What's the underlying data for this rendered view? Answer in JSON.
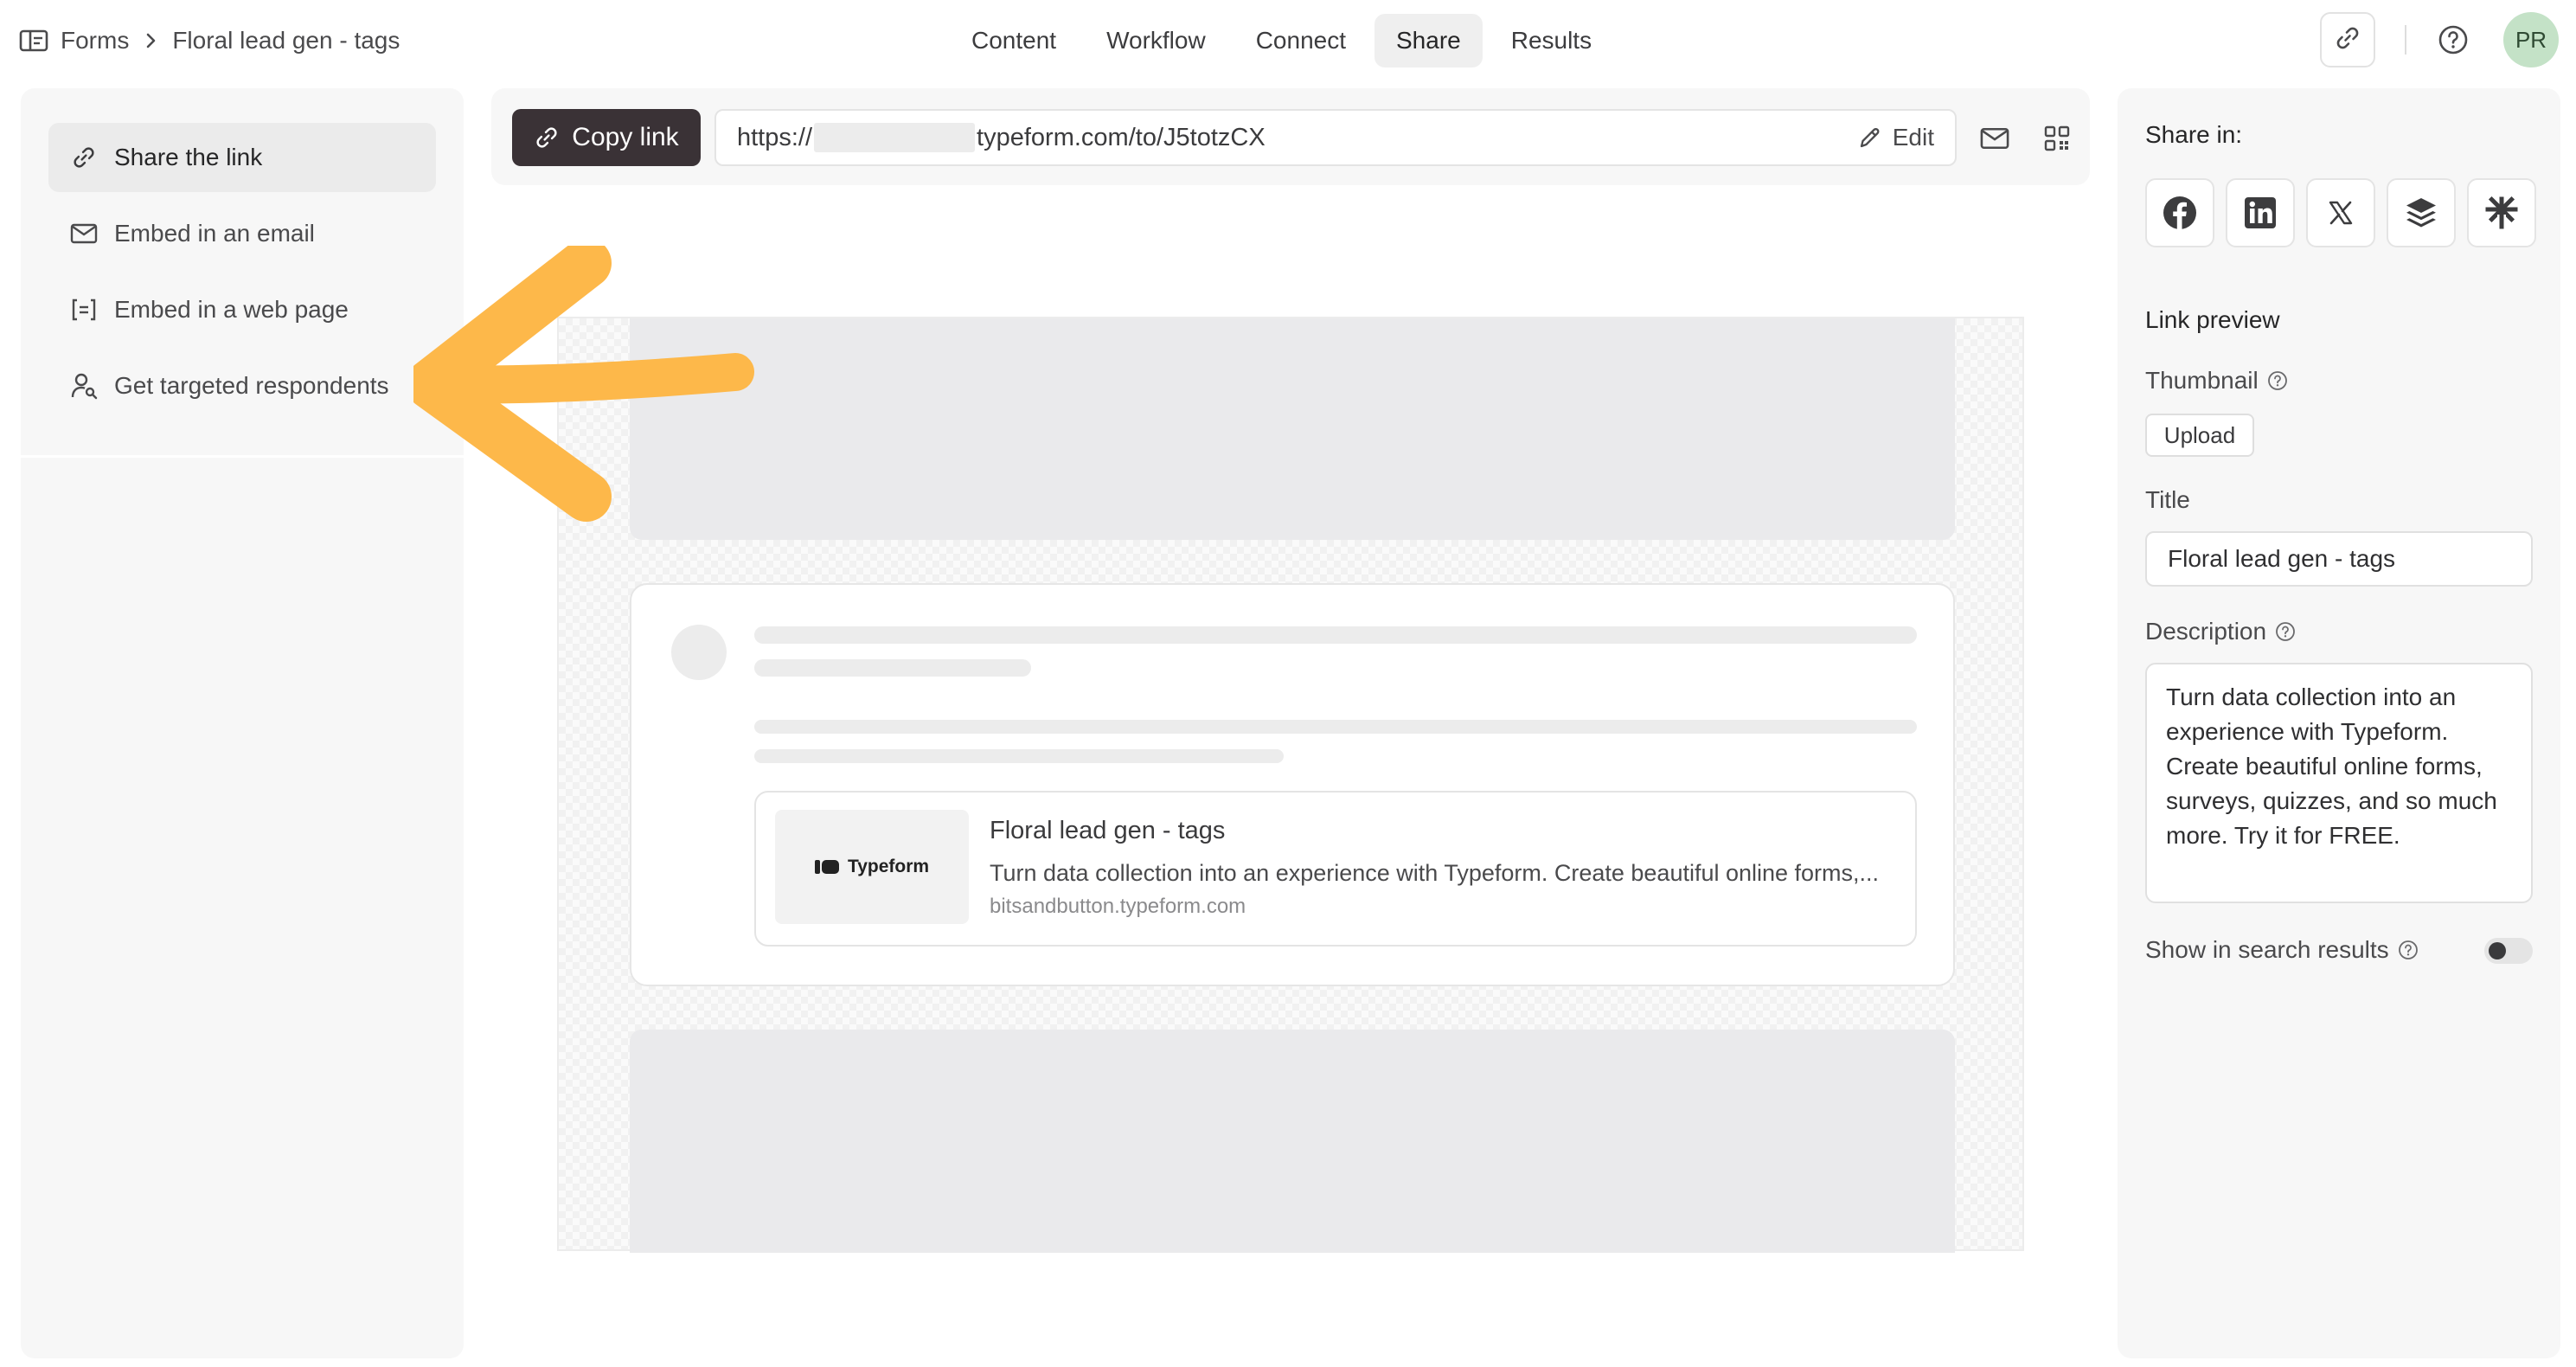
{
  "breadcrumb": {
    "root": "Forms",
    "current": "Floral lead gen - tags"
  },
  "nav_tabs": [
    {
      "label": "Content",
      "active": false
    },
    {
      "label": "Workflow",
      "active": false
    },
    {
      "label": "Connect",
      "active": false
    },
    {
      "label": "Share",
      "active": true
    },
    {
      "label": "Results",
      "active": false
    }
  ],
  "header_right": {
    "link_icon": "link-icon",
    "help_icon": "help-circle-icon",
    "avatar_initials": "PR",
    "avatar_color": "#c4e2c7"
  },
  "left_nav": {
    "items": [
      {
        "label": "Share the link",
        "icon": "link-icon",
        "active": true
      },
      {
        "label": "Embed in an email",
        "icon": "mail-icon",
        "active": false
      },
      {
        "label": "Embed in a web page",
        "icon": "embed-code-icon",
        "active": false
      },
      {
        "label": "Get targeted respondents",
        "icon": "person-search-icon",
        "active": false
      }
    ]
  },
  "share_bar": {
    "copy_label": "Copy link",
    "url_prefix": "https://",
    "url_suffix": "typeform.com/to/J5totzCX",
    "edit_label": "Edit",
    "copy_button_color": "#3a3236"
  },
  "preview": {
    "logo_text": "Typeform",
    "card_title": "Floral lead gen - tags",
    "card_description": "Turn data collection into an experience with Typeform. Create beautiful online forms,...",
    "card_domain": "bitsandbutton.typeform.com"
  },
  "annotation": {
    "arrow_color": "#fdb84a"
  },
  "right_panel": {
    "share_in_label": "Share in:",
    "social_icons": [
      "facebook-icon",
      "linkedin-icon",
      "x-icon",
      "buffer-icon",
      "asterisk-icon"
    ],
    "link_preview_label": "Link preview",
    "thumbnail_label": "Thumbnail",
    "upload_label": "Upload",
    "title_label": "Title",
    "title_value": "Floral lead gen - tags",
    "description_label": "Description",
    "description_value": "Turn data collection into an experience with Typeform. Create beautiful online forms, surveys, quizzes, and so much more. Try it for FREE.",
    "search_results_label": "Show in search results",
    "search_results_enabled": false
  }
}
